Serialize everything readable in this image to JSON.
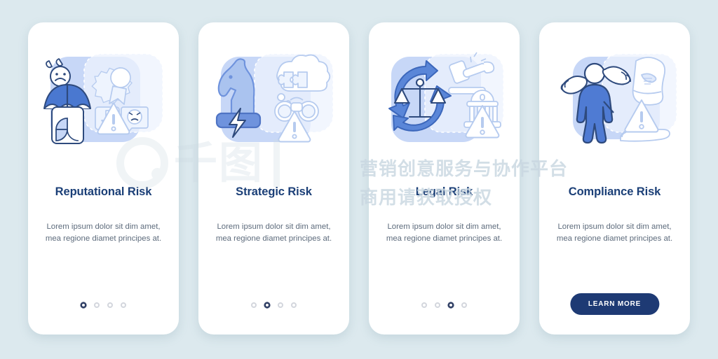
{
  "page": {
    "background_color": "#dce9ee",
    "title_color": "#1b3f77",
    "accent_color": "#4d7fd4",
    "cta_color": "#1e3a74"
  },
  "watermark": {
    "logo_text": "千图",
    "line1": "营销创意服务与协作平台",
    "line2": "商用请获取授权"
  },
  "screens": [
    {
      "id": "reputational-risk",
      "title": "Reputational Risk",
      "description": "Lorem ipsum dolor sit dim amet, mea regione diamet principes at.",
      "dots": {
        "count": 4,
        "active_index": 0
      },
      "cta": null,
      "icons": [
        "sad-person-with-umbrella-icon",
        "award-ribbon-icon",
        "thumbs-down-icon",
        "angry-face-speech-bubble-icon",
        "warning-triangle-icon"
      ]
    },
    {
      "id": "strategic-risk",
      "title": "Strategic Risk",
      "description": "Lorem ipsum dolor sit dim amet, mea regione diamet principes at.",
      "dots": {
        "count": 4,
        "active_index": 1
      },
      "cta": null,
      "icons": [
        "chess-knight-icon",
        "lightning-bolt-icon",
        "thought-bubble-puzzle-icon",
        "binoculars-icon",
        "warning-triangle-icon"
      ]
    },
    {
      "id": "legal-risk",
      "title": "Legal Risk",
      "description": "Lorem ipsum dolor sit dim amet, mea regione diamet principes at.",
      "dots": {
        "count": 4,
        "active_index": 2
      },
      "cta": null,
      "icons": [
        "scales-of-justice-icon",
        "circular-arrows-icon",
        "gavel-icon",
        "courthouse-icon",
        "warning-triangle-icon"
      ]
    },
    {
      "id": "compliance-risk",
      "title": "Compliance Risk",
      "description": "Lorem ipsum dolor sit dim amet, mea regione diamet principes at.",
      "dots": null,
      "cta": {
        "label": "LEARN MORE"
      },
      "icons": [
        "person-icon",
        "pointing-hand-icon",
        "harassment-icon",
        "warning-triangle-icon"
      ]
    }
  ]
}
